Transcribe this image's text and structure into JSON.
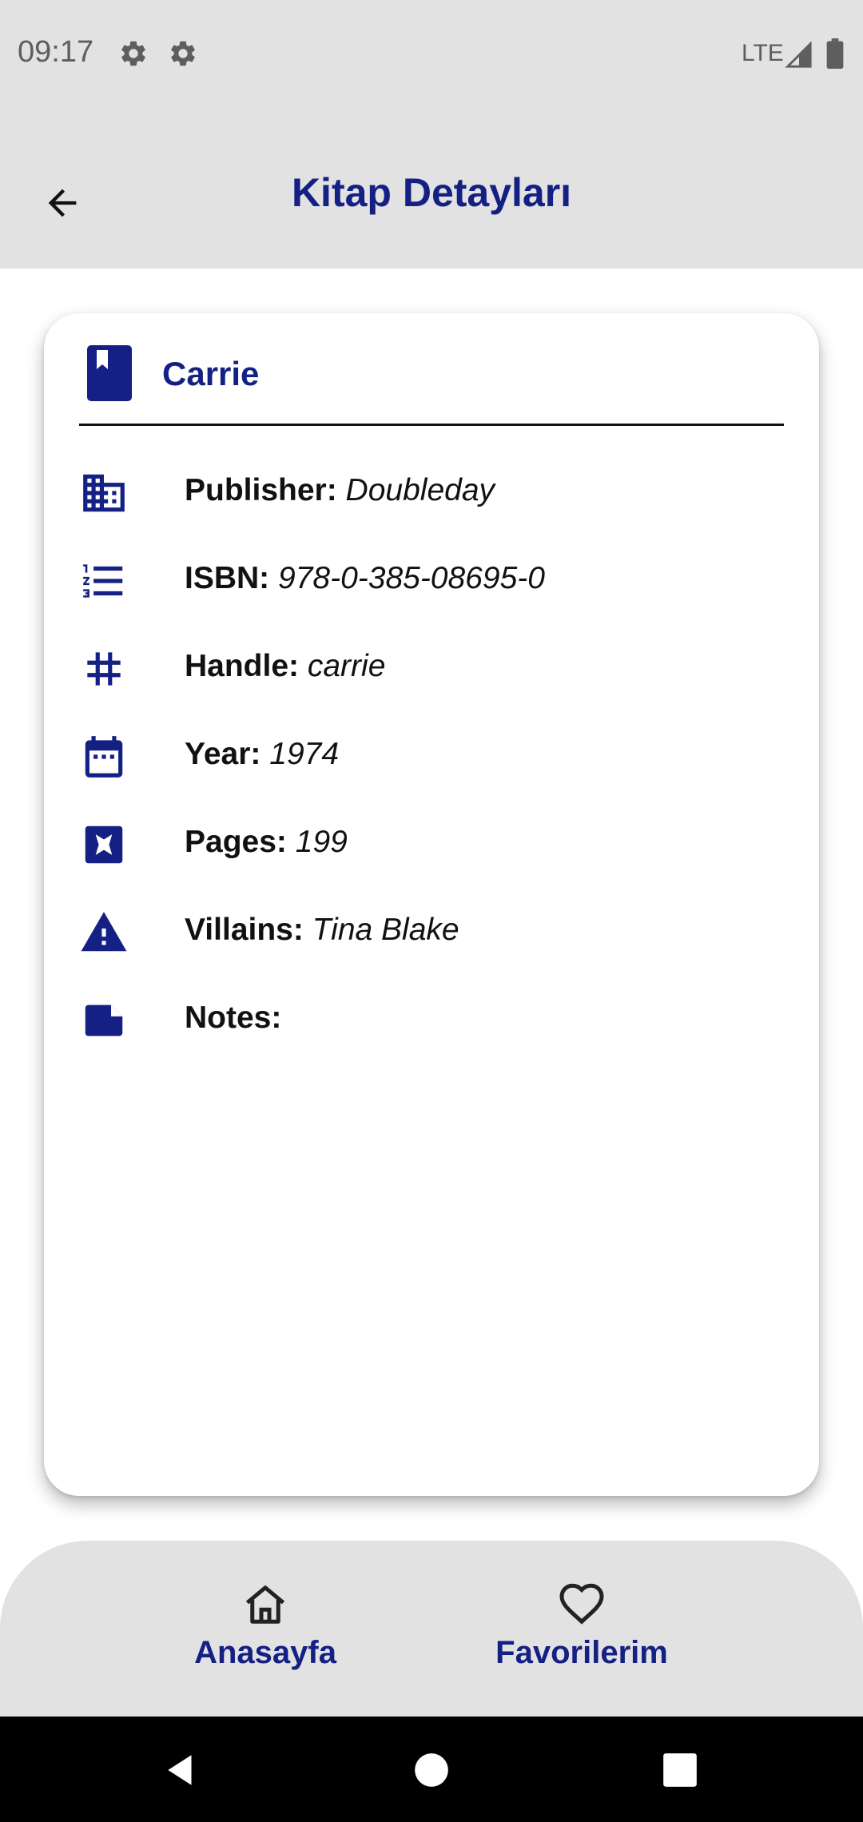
{
  "status_bar": {
    "time": "09:17",
    "network": "LTE",
    "icons": [
      "gear-icon",
      "gear-icon",
      "signal-icon",
      "battery-icon"
    ]
  },
  "app_bar": {
    "title": "Kitap Detayları",
    "back_icon": "arrow-back-icon"
  },
  "book": {
    "title": "Carrie",
    "details": [
      {
        "icon": "building-icon",
        "label": "Publisher:",
        "value": "Doubleday"
      },
      {
        "icon": "numbered-list-icon",
        "label": "ISBN:",
        "value": "978-0-385-08695-0"
      },
      {
        "icon": "hashtag-icon",
        "label": "Handle:",
        "value": "carrie"
      },
      {
        "icon": "calendar-icon",
        "label": "Year:",
        "value": "1974"
      },
      {
        "icon": "pages-icon",
        "label": "Pages:",
        "value": "199"
      },
      {
        "icon": "warning-icon",
        "label": "Villains:",
        "value": "Tina Blake"
      },
      {
        "icon": "note-icon",
        "label": "Notes:",
        "value": ""
      }
    ]
  },
  "bottom_nav": {
    "items": [
      {
        "icon": "home-icon",
        "label": "Anasayfa"
      },
      {
        "icon": "heart-icon",
        "label": "Favorilerim"
      }
    ]
  },
  "colors": {
    "accent": "#142083",
    "bar_background": "#e2e2e2",
    "text": "#111111"
  }
}
